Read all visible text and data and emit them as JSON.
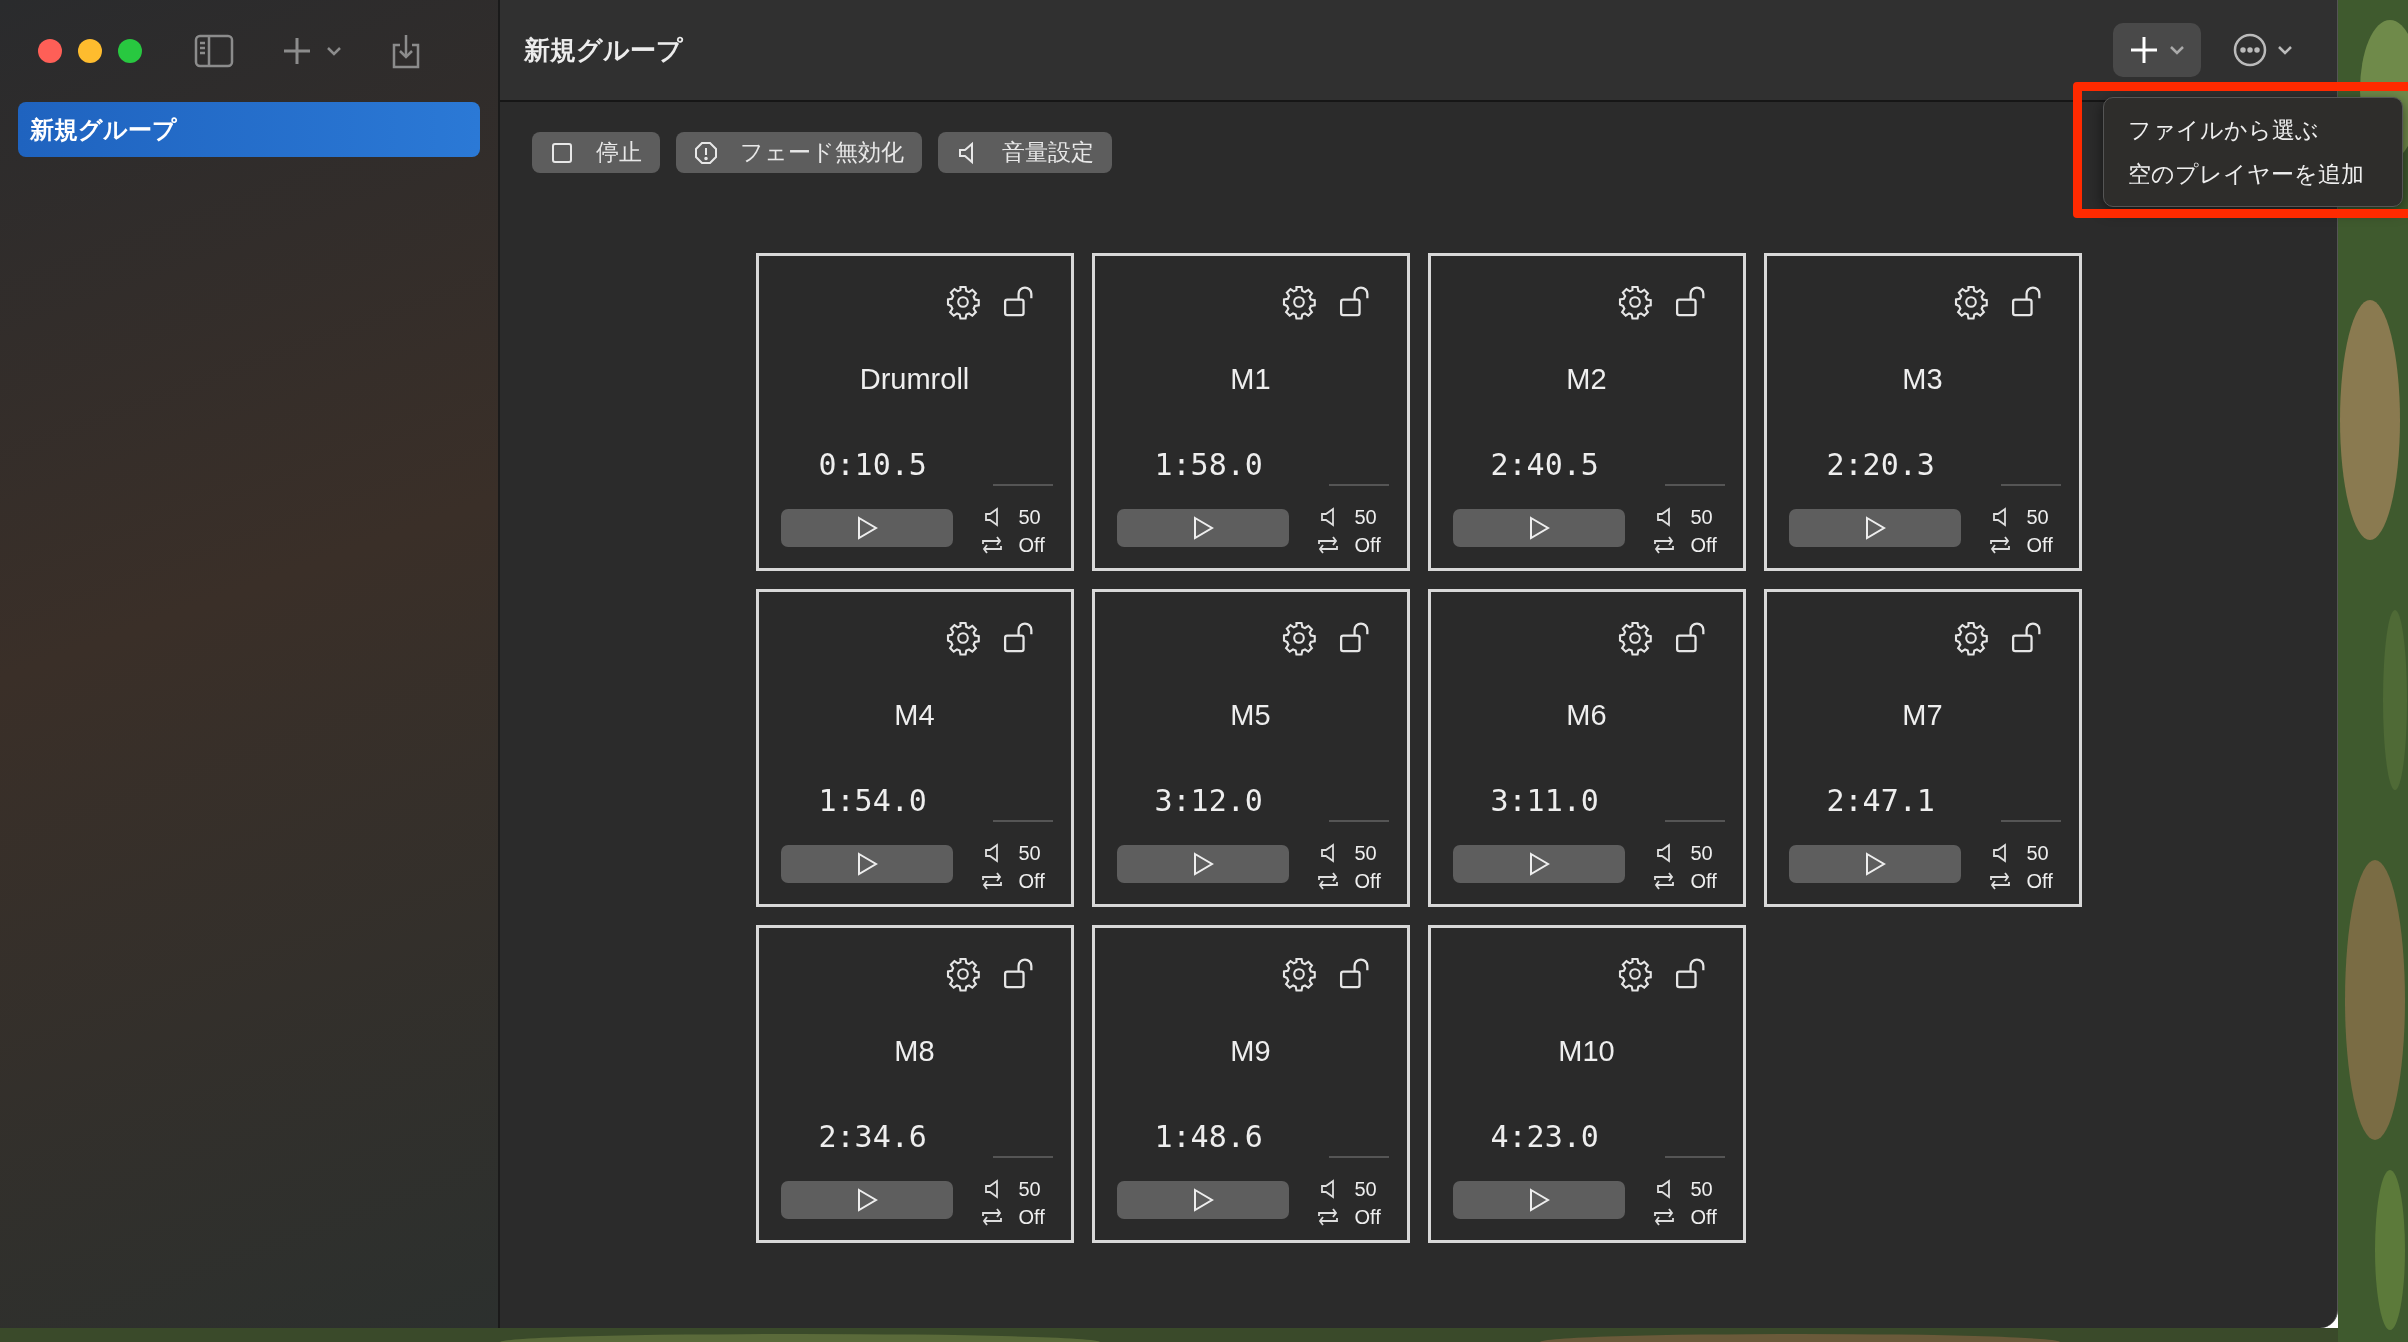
{
  "window": {
    "title": "新規グループ"
  },
  "sidebar": {
    "items": [
      {
        "label": "新規グループ",
        "selected": true
      }
    ]
  },
  "toolbar": {
    "buttons": [
      {
        "kind": "stop",
        "label": "停止"
      },
      {
        "kind": "fade",
        "label": "フェード無効化"
      },
      {
        "kind": "volume",
        "label": "音量設定"
      }
    ]
  },
  "players": [
    {
      "name": "Drumroll",
      "time": "0:10.5",
      "volume": "50",
      "loop": "Off"
    },
    {
      "name": "M1",
      "time": "1:58.0",
      "volume": "50",
      "loop": "Off"
    },
    {
      "name": "M2",
      "time": "2:40.5",
      "volume": "50",
      "loop": "Off"
    },
    {
      "name": "M3",
      "time": "2:20.3",
      "volume": "50",
      "loop": "Off"
    },
    {
      "name": "M4",
      "time": "1:54.0",
      "volume": "50",
      "loop": "Off"
    },
    {
      "name": "M5",
      "time": "3:12.0",
      "volume": "50",
      "loop": "Off"
    },
    {
      "name": "M6",
      "time": "3:11.0",
      "volume": "50",
      "loop": "Off"
    },
    {
      "name": "M7",
      "time": "2:47.1",
      "volume": "50",
      "loop": "Off"
    },
    {
      "name": "M8",
      "time": "2:34.6",
      "volume": "50",
      "loop": "Off"
    },
    {
      "name": "M9",
      "time": "1:48.6",
      "volume": "50",
      "loop": "Off"
    },
    {
      "name": "M10",
      "time": "4:23.0",
      "volume": "50",
      "loop": "Off"
    }
  ],
  "add_menu": {
    "items": [
      {
        "label": "ファイルから選ぶ"
      },
      {
        "label": "空のプレイヤーを追加"
      }
    ]
  }
}
